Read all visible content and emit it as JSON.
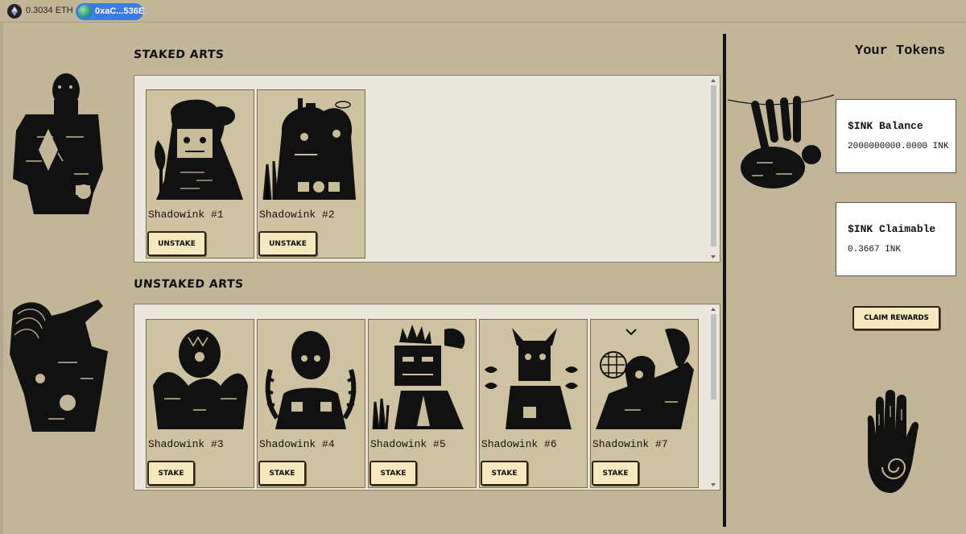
{
  "wallet": {
    "eth_balance": "0.3034 ETH",
    "account": "0xaC...536E",
    "icons": [
      "ethereum-icon",
      "account-avatar"
    ]
  },
  "staked": {
    "title": "STAKED ARTS",
    "items": [
      {
        "name": "Shadowink #1",
        "button": "UNSTAKE"
      },
      {
        "name": "Shadowink #2",
        "button": "UNSTAKE"
      }
    ]
  },
  "unstaked": {
    "title": "UNSTAKED ARTS",
    "items": [
      {
        "name": "Shadowink #3",
        "button": "STAKE"
      },
      {
        "name": "Shadowink #4",
        "button": "STAKE"
      },
      {
        "name": "Shadowink #5",
        "button": "STAKE"
      },
      {
        "name": "Shadowink #6",
        "button": "STAKE"
      },
      {
        "name": "Shadowink #7",
        "button": "STAKE"
      }
    ]
  },
  "tokens": {
    "title": "Your Tokens",
    "balance_label": "$INK Balance",
    "balance_value": "2000000000.0000 INK",
    "claimable_label": "$INK Claimable",
    "claimable_value": "0.3667 INK",
    "claim_button": "CLAIM REWARDS"
  },
  "colors": {
    "background": "#c3b597",
    "button": "#f7e8bf",
    "ink": "#111111",
    "account_pill": "#3b7be6"
  }
}
